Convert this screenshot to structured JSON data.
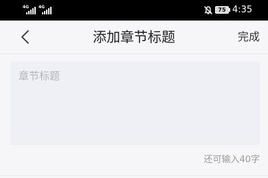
{
  "status_bar": {
    "sim1_network": "4G",
    "sim2_network": "4G",
    "battery_level": "75",
    "time": "4:35"
  },
  "header": {
    "title": "添加章节标题",
    "done_label": "完成"
  },
  "editor": {
    "value": "",
    "placeholder": "章节标题",
    "remaining_text": "还可输入40字"
  }
}
